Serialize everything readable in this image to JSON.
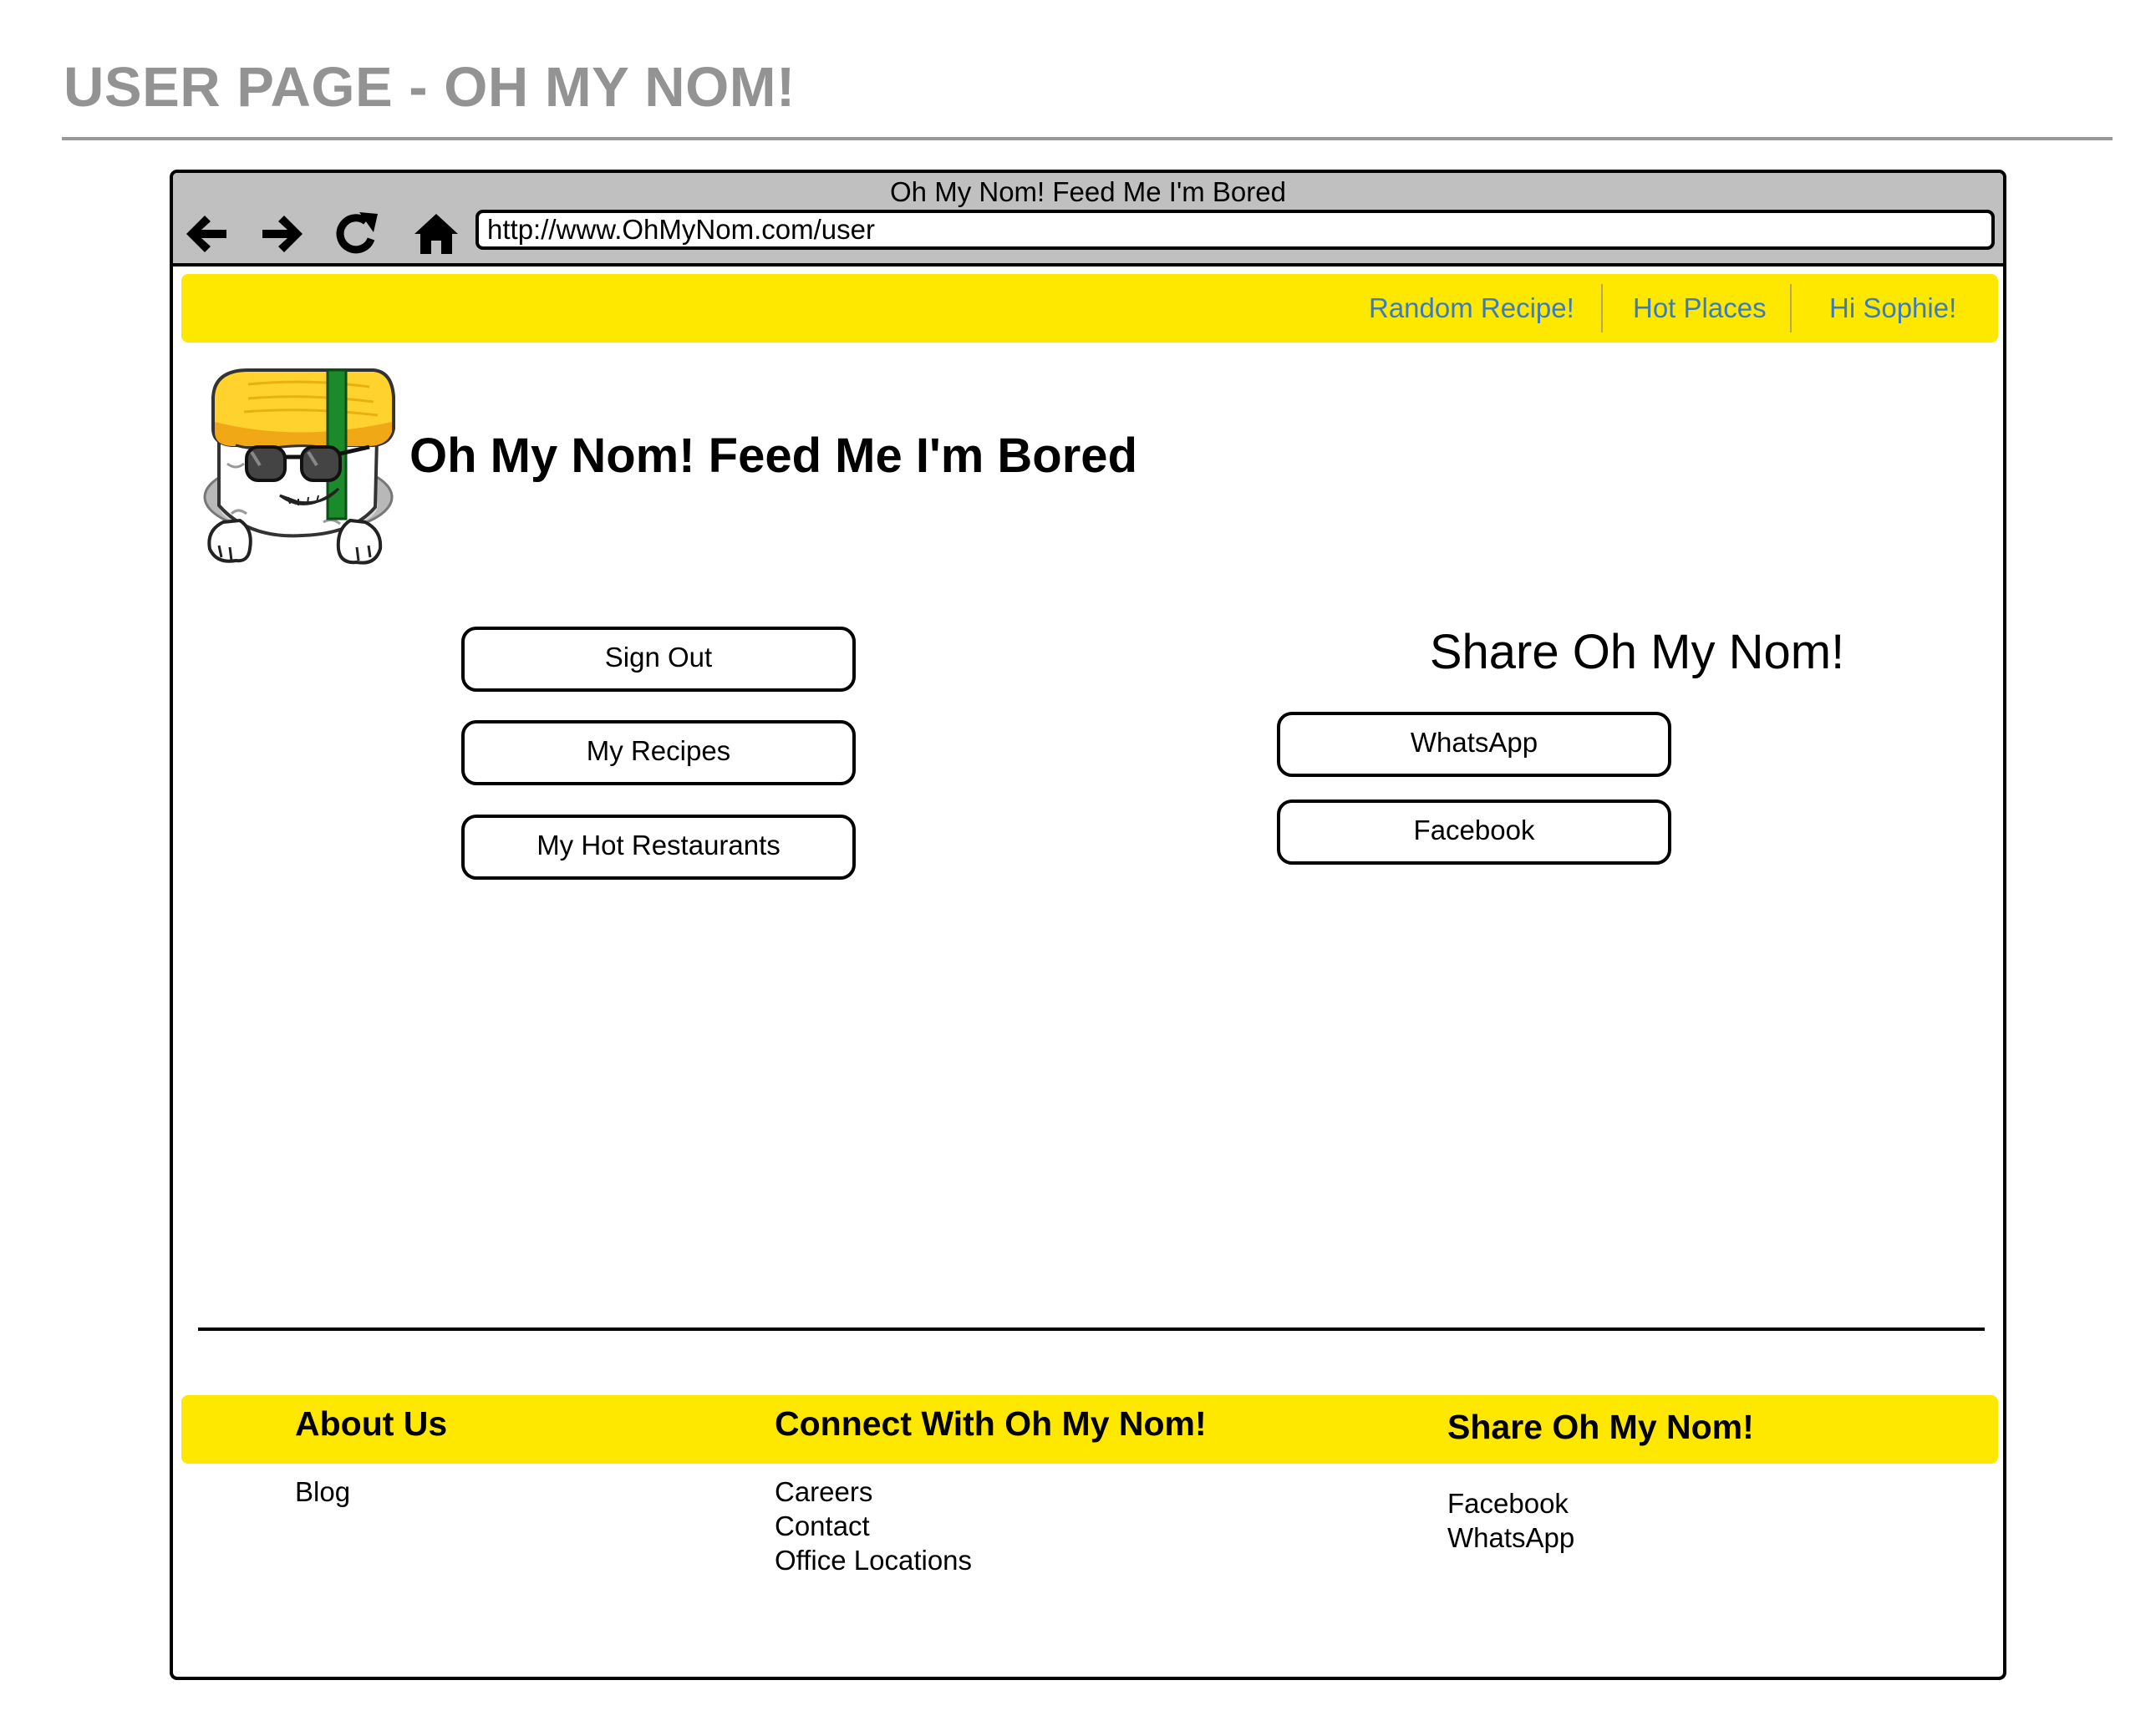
{
  "page": {
    "title": "USER PAGE - OH MY NOM!"
  },
  "browser": {
    "window_title": "Oh My Nom! Feed Me I'm Bored",
    "url": "http://www.OhMyNom.com/user",
    "nav_icons": [
      "back-arrow-icon",
      "forward-arrow-icon",
      "refresh-icon",
      "home-icon"
    ]
  },
  "top_nav": {
    "links": [
      {
        "label": "Random Recipe!"
      },
      {
        "label": "Hot Places"
      },
      {
        "label": "Hi Sophie!"
      }
    ],
    "link_color": "#3b7cbf",
    "bar_color": "#ffe800"
  },
  "header": {
    "logo": "sushi-mascot-logo",
    "site_title": "Oh My Nom! Feed Me I'm Bored"
  },
  "account_actions": {
    "buttons": [
      {
        "label": "Sign Out"
      },
      {
        "label": "My Recipes"
      },
      {
        "label": "My Hot Restaurants"
      }
    ]
  },
  "share": {
    "heading": "Share Oh My Nom!",
    "buttons": [
      {
        "label": "WhatsApp"
      },
      {
        "label": "Facebook"
      }
    ]
  },
  "footer": {
    "columns": [
      {
        "heading": "About Us",
        "links": [
          "Blog"
        ]
      },
      {
        "heading": "Connect With Oh My Nom!",
        "links": [
          "Careers",
          "Contact",
          "Office Locations"
        ]
      },
      {
        "heading": "Share Oh My Nom!",
        "links": [
          "Facebook",
          "WhatsApp"
        ]
      }
    ]
  }
}
